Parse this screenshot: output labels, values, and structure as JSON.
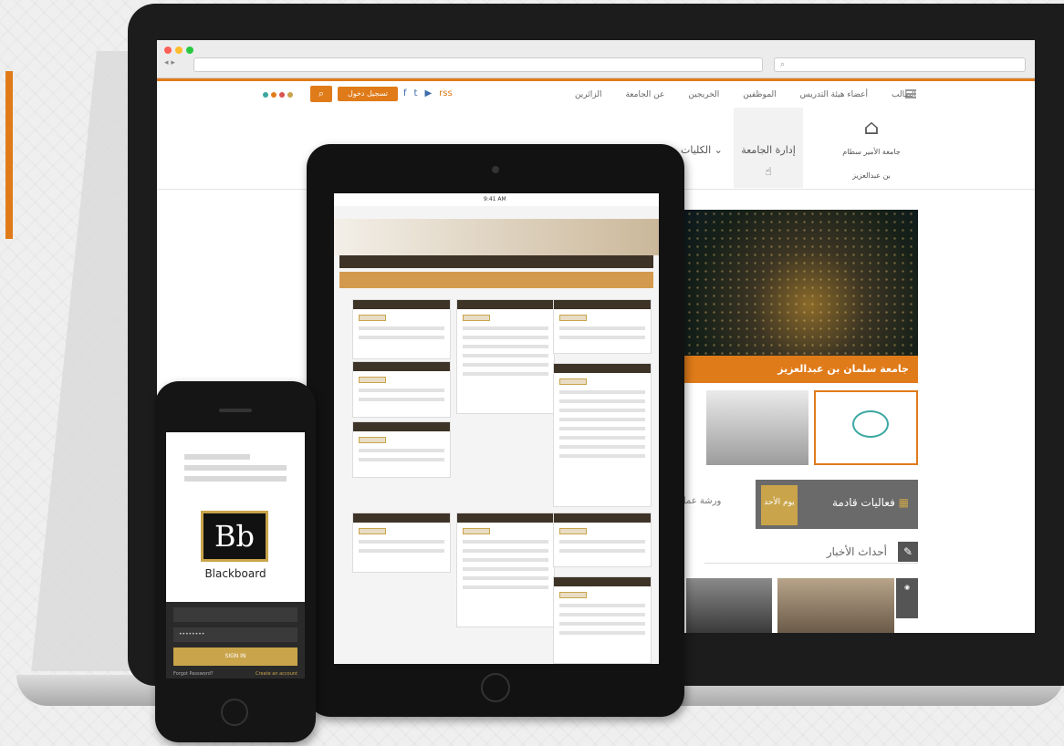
{
  "browser": {
    "url": "",
    "search_placeholder": ""
  },
  "topnav": {
    "items": [
      "الطالب",
      "أعضاء هيئة التدريس",
      "الموظفين",
      "الخريجين",
      "عن الجامعة",
      "الزائرين"
    ],
    "login_label": "تسجيل دخول",
    "search_icon": "search-icon",
    "social": [
      "f",
      "t",
      "▶",
      "rss"
    ]
  },
  "mainnav": {
    "logo_text": "جامعة الأمير سطام بن عبدالعزيز",
    "active_item": "إدارة الجامعة",
    "items": [
      "الكليات",
      "",
      "",
      ""
    ]
  },
  "hero": {
    "caption": "جامعة سلمان بن عبدالعزيز"
  },
  "events": {
    "title": "فعاليات قادمة",
    "date_day": "يوم الأحد",
    "side_text": "ورشة عمل التعل"
  },
  "news": {
    "title": "أحداث الأخبار"
  },
  "colors": {
    "accent": "#e07b1a",
    "dark": "#3e3327",
    "gold": "#c9a44a"
  },
  "blackboard": {
    "logo": "Bb",
    "name": "Blackboard",
    "username_value": "",
    "password_mask": "••••••••",
    "sign_in": "SIGN IN",
    "forgot": "Forgot Password?",
    "create": "Create an account"
  },
  "tablet": {
    "status_time": "9:41 AM"
  }
}
